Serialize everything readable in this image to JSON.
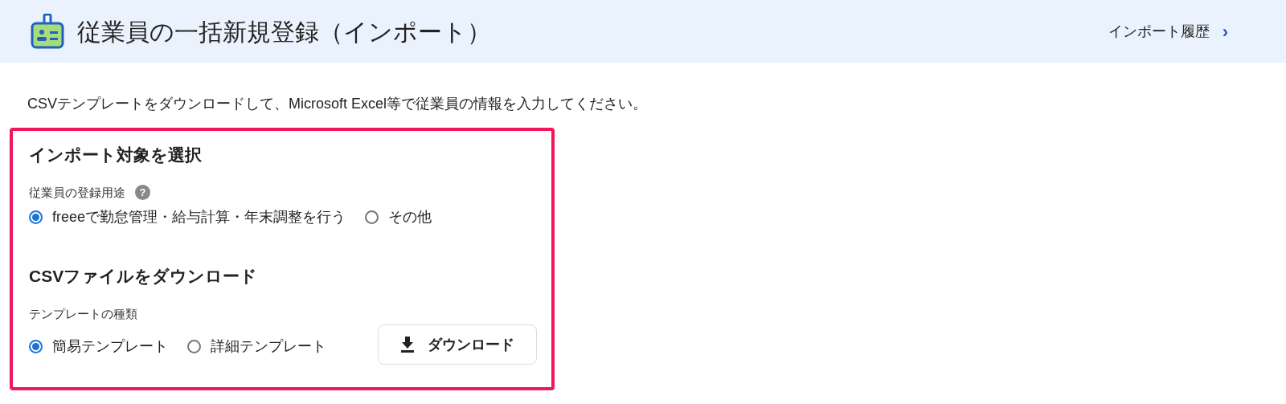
{
  "header": {
    "title": "従業員の一括新規登録（インポート）",
    "history_link": "インポート履歴",
    "chevron": "›"
  },
  "description": "CSVテンプレートをダウンロードして、Microsoft Excel等で従業員の情報を入力してください。",
  "sections": [
    {
      "heading": "インポート対象を選択",
      "field_label": "従業員の登録用途",
      "help": "?",
      "options": [
        {
          "label": "freeeで勤怠管理・給与計算・年末調整を行う",
          "selected": true
        },
        {
          "label": "その他",
          "selected": false
        }
      ]
    },
    {
      "heading": "CSVファイルをダウンロード",
      "field_label": "テンプレートの種類",
      "options": [
        {
          "label": "簡易テンプレート",
          "selected": true
        },
        {
          "label": "詳細テンプレート",
          "selected": false
        }
      ],
      "button": "ダウンロード"
    }
  ]
}
